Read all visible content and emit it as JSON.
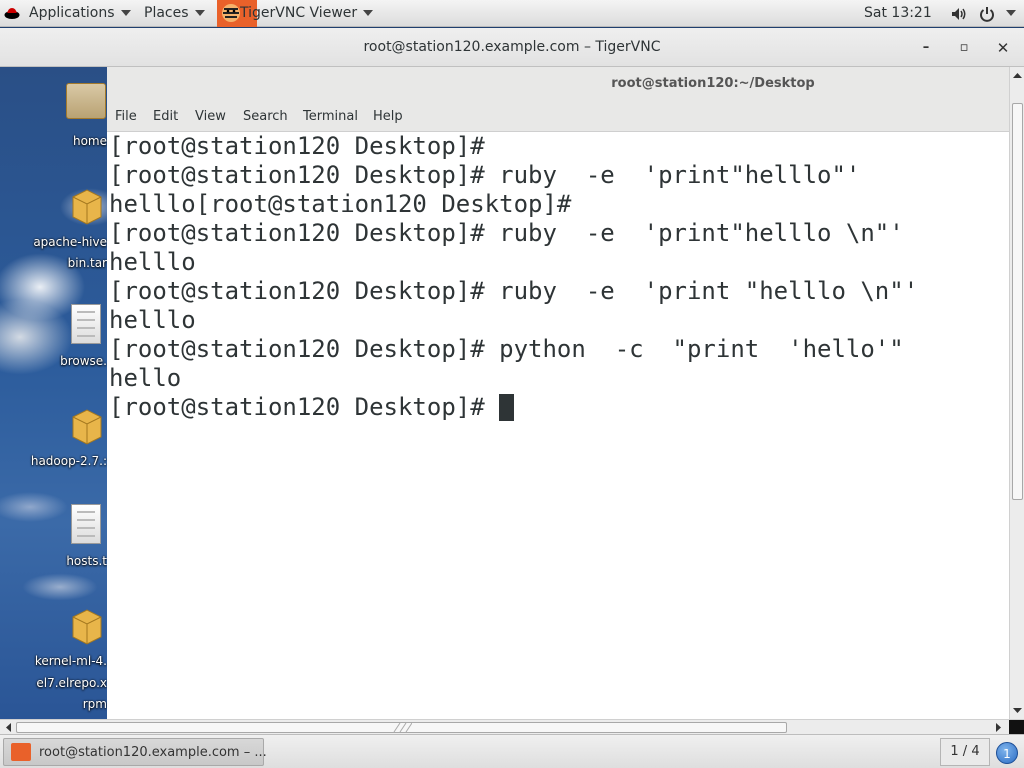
{
  "top_panel": {
    "applications_label": "Applications",
    "places_label": "Places",
    "vnc_menu_label": "TigerVNC Viewer",
    "clock": "Sat 13:21"
  },
  "vnc_window": {
    "title": "root@station120.example.com – TigerVNC"
  },
  "desktop": {
    "icons": [
      {
        "label": "home",
        "icon": "home-folder-icon"
      },
      {
        "label": "apache-hive",
        "label2": "bin.tar",
        "icon": "package-icon"
      },
      {
        "label": "browse.",
        "icon": "document-icon"
      },
      {
        "label": "hadoop-2.7.:",
        "icon": "package-icon"
      },
      {
        "label": "hosts.t",
        "icon": "document-icon"
      },
      {
        "label": "kernel-ml-4.",
        "label2": "el7.elrepo.x",
        "label3": "rpm",
        "icon": "package-icon"
      }
    ]
  },
  "terminal": {
    "title": "root@station120:~/Desktop",
    "menu": [
      "File",
      "Edit",
      "View",
      "Search",
      "Terminal",
      "Help"
    ],
    "lines": [
      "[root@station120 Desktop]#",
      "[root@station120 Desktop]# ruby  -e  'print\"helllo\"'",
      "helllo[root@station120 Desktop]#",
      "[root@station120 Desktop]# ruby  -e  'print\"helllo \\n\"'",
      "helllo",
      "[root@station120 Desktop]# ruby  -e  'print \"helllo \\n\"'",
      "helllo",
      "[root@station120 Desktop]# python  -c  \"print  'hello'\"",
      "hello",
      "[root@station120 Desktop]# "
    ]
  },
  "taskbar": {
    "task_label": "root@station120.example.com – ...",
    "workspace": "1 / 4",
    "workspace_badge": "1"
  },
  "colors": {
    "terminal_bg": "#ffffff",
    "terminal_fg": "#2e3436",
    "panel_bg": "#e8e8e7",
    "vnc_accent": "#e9612a"
  }
}
